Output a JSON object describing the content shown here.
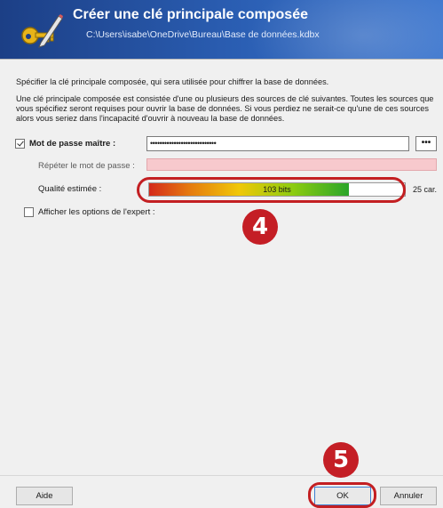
{
  "header": {
    "title": "Créer une clé principale composée",
    "path": "C:\\Users\\isabe\\OneDrive\\Bureau\\Base de données.kdbx",
    "icon": "key-pencil-icon"
  },
  "intro": {
    "line1": "Spécifier la clé principale composée, qui sera utilisée pour chiffrer la base de données.",
    "line2": "Une clé principale composée est consistée d'une ou plusieurs des sources de clé suivantes. Toutes les sources que vous spécifiez seront requises pour ouvrir la base de données. Si vous perdiez ne serait-ce qu'une de ces sources alors vous seriez dans l'incapacité d'ouvrir à nouveau la base de données."
  },
  "master_password": {
    "label": "Mot de passe maître :",
    "checked": true,
    "value": "••••••••••••••••••••••••••••",
    "reveal_button": "•••"
  },
  "repeat_password": {
    "label": "Répéter le mot de passe :",
    "value": ""
  },
  "quality": {
    "label": "Qualité estimée :",
    "bar_text": "103 bits",
    "fill_fraction": 0.78,
    "chars": "25 car."
  },
  "expert": {
    "label": "Afficher les options de l'expert :",
    "checked": false
  },
  "annotations": {
    "step4": "4",
    "step5": "5",
    "color": "#c41e25"
  },
  "buttons": {
    "help": "Aide",
    "ok": "OK",
    "cancel": "Annuler"
  }
}
